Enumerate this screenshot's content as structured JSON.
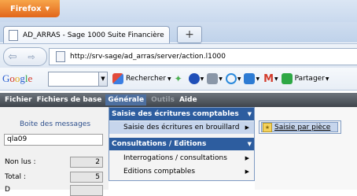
{
  "browser": {
    "menu_button": "Firefox",
    "tab_title": "AD_ARRAS - Sage 1000 Suite Financière",
    "new_tab": "+",
    "url": "http://srv-sage/ad_arras/server/action.l1000"
  },
  "google_toolbar": {
    "logo": "Google",
    "search_value": "",
    "search_label": "Rechercher",
    "share_label": "Partager"
  },
  "app_menu": {
    "items": [
      "Fichier",
      "Fichiers de base",
      "Générale",
      "Outils",
      "Aide"
    ],
    "active": "Générale"
  },
  "left_panel": {
    "messages_link": "Boite des messages",
    "user": "qla09",
    "non_lus_label": "Non lus :",
    "non_lus_value": "2",
    "total_label": "Total :",
    "total_value": "5",
    "partial_label": "D"
  },
  "dropdown": {
    "section1_title": "Saisie des écritures comptables",
    "section1_item": "Saisie des écritures en brouillard",
    "section2_title": "Consultations / Editions",
    "section2_items": [
      "Interrogations / consultations",
      "Editions comptables"
    ]
  },
  "submenu": {
    "item": "Saisie par pièce"
  },
  "colors": {
    "menu_header_blue": "#2d5d9f",
    "highlight": "#c6d5ec",
    "firefox_orange": "#e2661b"
  }
}
